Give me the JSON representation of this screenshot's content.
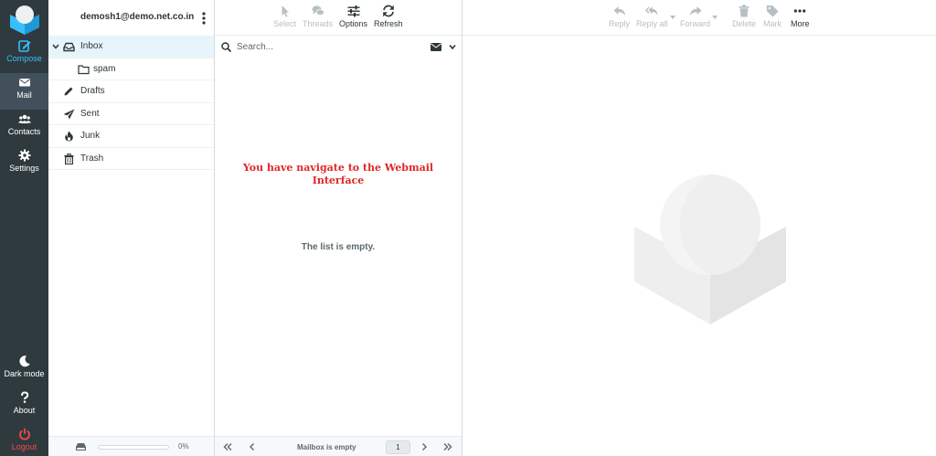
{
  "nav": {
    "compose": "Compose",
    "mail": "Mail",
    "contacts": "Contacts",
    "settings": "Settings",
    "dark_mode": "Dark mode",
    "about": "About",
    "logout": "Logout"
  },
  "account": {
    "email": "demosh1@demo.net.co.in"
  },
  "folders": [
    {
      "label": "Inbox",
      "icon": "inbox-icon",
      "active": true
    },
    {
      "label": "spam",
      "icon": "folder-icon",
      "active": false
    },
    {
      "label": "Drafts",
      "icon": "pencil-icon",
      "active": false
    },
    {
      "label": "Sent",
      "icon": "paper-plane-icon",
      "active": false
    },
    {
      "label": "Junk",
      "icon": "fire-icon",
      "active": false
    },
    {
      "label": "Trash",
      "icon": "trash-icon",
      "active": false
    }
  ],
  "quota": {
    "percent_label": "0%",
    "percent": 0
  },
  "list_toolbar": {
    "select": "Select",
    "threads": "Threads",
    "options": "Options",
    "refresh": "Refresh"
  },
  "search": {
    "placeholder": "Search..."
  },
  "notice": "You have navigate to the Webmail Interface",
  "empty_message": "The list is empty.",
  "list_footer": {
    "status": "Mailbox is empty",
    "page": "1"
  },
  "preview_toolbar": {
    "reply": "Reply",
    "reply_all": "Reply all",
    "forward": "Forward",
    "delete": "Delete",
    "mark": "Mark",
    "more": "More"
  },
  "colors": {
    "accent": "#37beff",
    "rail": "#2f3a3f",
    "danger": "#f34a4a",
    "notice": "#e02727"
  }
}
